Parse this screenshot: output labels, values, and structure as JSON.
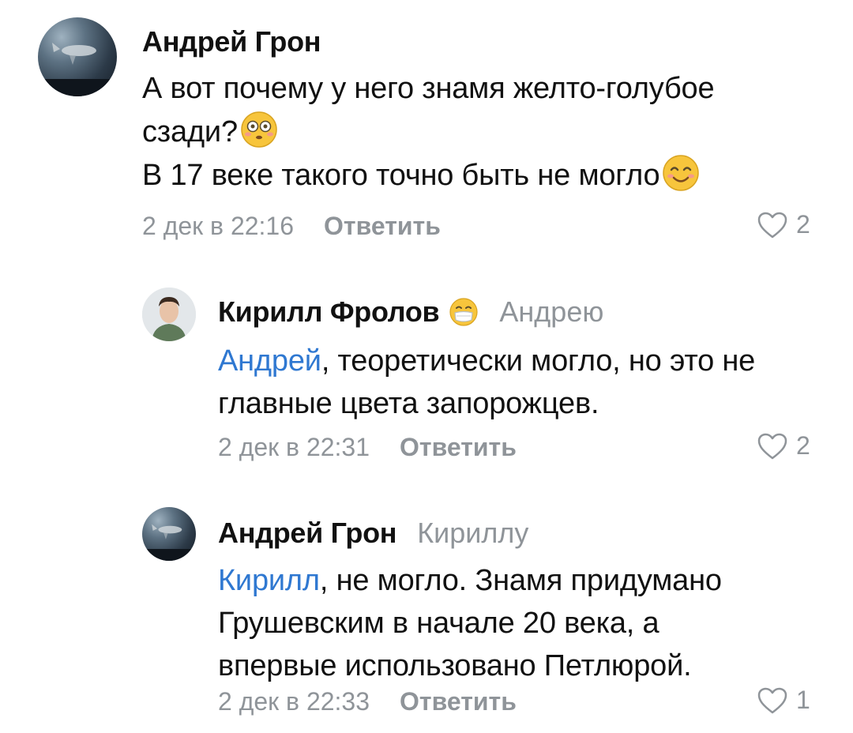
{
  "comments": [
    {
      "author": "Андрей Грон",
      "text_line1": "А вот почему у него знамя желто-голубое",
      "text_line2": "сзади?",
      "text_line3": "В 17 веке такого точно быть не могло",
      "date": "2 дек в 22:16",
      "reply_label": "Ответить",
      "likes": "2"
    },
    {
      "author": "Кирилл Фролов",
      "reply_to": "Андрею",
      "mention": "Андрей",
      "text_line1_rest": ", теоретически могло, но это не",
      "text_line2": "главные цвета запорожцев.",
      "date": "2 дек в 22:31",
      "reply_label": "Ответить",
      "likes": "2"
    },
    {
      "author": "Андрей Грон",
      "reply_to": "Кириллу",
      "mention": "Кирилл",
      "text_line1_rest": ", не могло. Знамя придумано",
      "text_line2": "Грушевским в начале 20 века, а",
      "text_line3": "впервые использовано Петлюрой.",
      "date": "2 дек в 22:33",
      "reply_label": "Ответить",
      "likes": "1"
    }
  ],
  "icons": {
    "like": "heart-outline-icon",
    "emoji1": "flushed-face-icon",
    "emoji2": "smiling-face-icon",
    "emoji3": "mask-face-icon"
  },
  "colors": {
    "mention": "#2f78d1",
    "secondary": "#8f9499",
    "emoji": "#f7c53c"
  }
}
